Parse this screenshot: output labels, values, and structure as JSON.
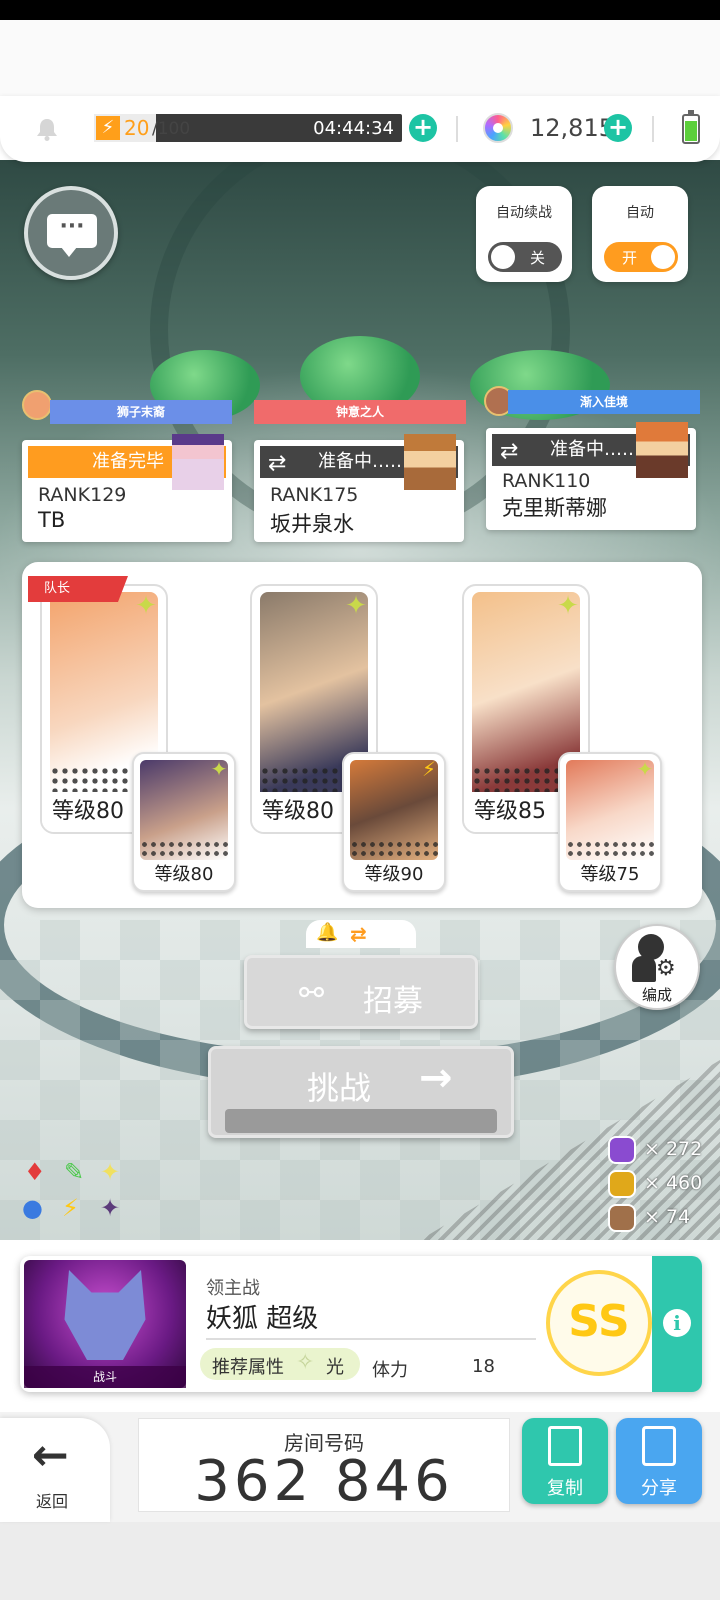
{
  "topbar": {
    "stamina_current": "20",
    "stamina_max": "/100",
    "stamina_fraction": 0.2,
    "timer": "04:44:34",
    "gems": "12,815",
    "battery_level": 0.75,
    "bell_icon": "bell-icon"
  },
  "toggles": {
    "auto_continue": {
      "label": "自动续战",
      "state": "关",
      "on": false
    },
    "auto": {
      "label": "自动",
      "state": "开",
      "on": true
    }
  },
  "players": [
    {
      "title": "狮子末裔",
      "status": "准备完毕",
      "ready": true,
      "rank": "RANK129",
      "name": "TB",
      "banner_color": "#6b8fe8"
    },
    {
      "title": "钟意之人",
      "status": "准备中……",
      "ready": false,
      "rank": "RANK175",
      "name": "坂井泉水",
      "banner_color": "#f06b6b"
    },
    {
      "title": "渐入佳境",
      "status": "准备中……",
      "ready": false,
      "rank": "RANK110",
      "name": "克里斯蒂娜",
      "banner_color": "#4a8fe8"
    }
  ],
  "team": {
    "leader_label": "队长",
    "heroes": [
      {
        "level": "等级80",
        "sub_level": "等级80",
        "art": "#f3a36b",
        "sub_art": "#4b3a6a"
      },
      {
        "level": "等级80",
        "sub_level": "等级90",
        "art": "#8a7a6a",
        "sub_art": "#d47a3a"
      },
      {
        "level": "等级85",
        "sub_level": "等级75",
        "art": "#f3c08a",
        "sub_art": "#e27a5a"
      }
    ]
  },
  "actions": {
    "recruit": "招募",
    "challenge": "挑战",
    "formation": "编成"
  },
  "items": [
    {
      "count": "× 272",
      "color": "#8a4bd0"
    },
    {
      "count": "× 460",
      "color": "#e0a81a"
    },
    {
      "count": "× 74",
      "color": "#a0704a"
    }
  ],
  "boss": {
    "category": "领主战",
    "name": "妖狐 超级",
    "recommend_label": "推荐属性",
    "recommend_value": "光",
    "stamina_label": "体力",
    "stamina_value": "18",
    "rank": "SS",
    "fight_label": "战斗"
  },
  "bottom": {
    "back": "返回",
    "room_label": "房间号码",
    "room_number": "362 846",
    "copy": "复制",
    "share": "分享"
  }
}
